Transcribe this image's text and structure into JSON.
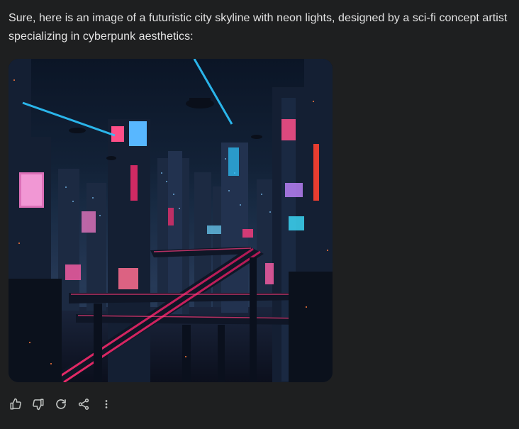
{
  "response": {
    "text": "Sure, here is an image of a futuristic city skyline with neon lights, designed by a sci-fi concept artist specializing in cyberpunk aesthetics:"
  },
  "actions": [
    {
      "name": "thumbs-up",
      "icon": "thumbs-up-icon"
    },
    {
      "name": "thumbs-down",
      "icon": "thumbs-down-icon"
    },
    {
      "name": "regenerate",
      "icon": "refresh-icon"
    },
    {
      "name": "share",
      "icon": "share-icon"
    },
    {
      "name": "more",
      "icon": "more-vertical-icon"
    }
  ],
  "colors": {
    "background": "#1e1f20",
    "text": "#e3e3e3",
    "icon": "#c4c7c5",
    "neon_cyan": "#2ec6ff",
    "neon_pink": "#ff3d7f"
  }
}
